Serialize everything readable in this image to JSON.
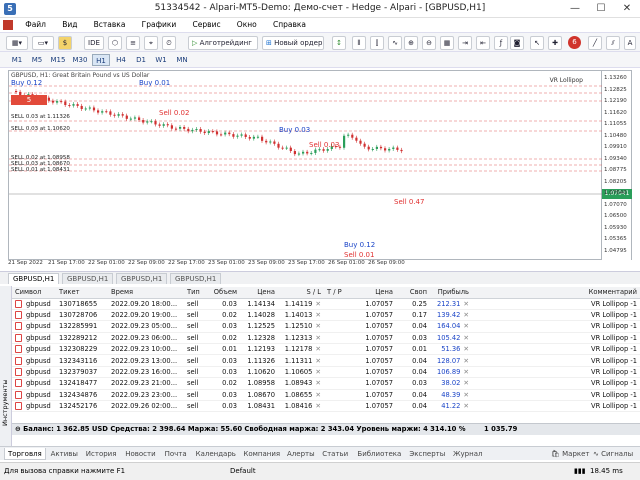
{
  "window": {
    "title": "51334542 - Alpari-MT5-Demo: Демо-счет - Hedge - Alpari - [GBPUSD,H1]"
  },
  "menu": [
    "Файл",
    "Вид",
    "Вставка",
    "Графики",
    "Сервис",
    "Окно",
    "Справка"
  ],
  "toolbar": {
    "ide": "IDE",
    "algo": "Алготрейдинг",
    "new_order": "Новый ордер",
    "badge": "6"
  },
  "timeframes": [
    "M1",
    "M5",
    "M15",
    "M30",
    "H1",
    "H4",
    "D1",
    "W1",
    "MN"
  ],
  "chart": {
    "header": "GBPUSD, H1: Great Britain Pound vs US Dollar",
    "expert": "VR Lollipop",
    "lot_badge": "5",
    "sell_labels": [
      "SELL 0.03 at 1.11326",
      "SELL 0.03 at 1.10620",
      "SELL 0.02 at 1.08958",
      "SELL 0.03 at 1.08670",
      "SELL 0.01 at 1.08431"
    ],
    "buy_labels": [
      "Buy 0.12",
      "Buy 0.01",
      "Buy 0.03",
      "Buy 0.12"
    ],
    "sell_small": [
      "Sell 0.02",
      "Sell 0.03",
      "Sell 0.01",
      "Sell 0.47"
    ],
    "current_price": "1.07041",
    "price_ticks": [
      "1.13260",
      "1.12825",
      "1.12190",
      "1.11620",
      "1.11055",
      "1.10480",
      "1.09910",
      "1.09340",
      "1.08775",
      "1.08205",
      "1.07640",
      "1.07070",
      "1.06500",
      "1.05930",
      "1.05365",
      "1.04795"
    ],
    "time_ticks": [
      "21 Sep 2022",
      "21 Sep 17:00",
      "22 Sep 01:00",
      "22 Sep 09:00",
      "22 Sep 17:00",
      "23 Sep 01:00",
      "23 Sep 09:00",
      "23 Sep 17:00",
      "26 Sep 01:00",
      "26 Sep 09:00"
    ]
  },
  "chart_tabs": [
    "GBPUSD,H1",
    "GBPUSD,H1",
    "GBPUSD,H1",
    "GBPUSD,H1"
  ],
  "table": {
    "headers": [
      "Символ",
      "Тикет",
      "Время",
      "Тип",
      "Объем",
      "Цена",
      "S / L",
      "T / P",
      "Цена",
      "Своп",
      "Прибыль",
      "Комментарий"
    ],
    "rows": [
      [
        "gbpusd",
        "130718655",
        "2022.09.20 18:00...",
        "sell",
        "0.03",
        "1.14134",
        "1.14119",
        "",
        "1.07057",
        "0.25",
        "212.31",
        "VR Lollipop -1"
      ],
      [
        "gbpusd",
        "130728706",
        "2022.09.20 19:00...",
        "sell",
        "0.02",
        "1.14028",
        "1.14013",
        "",
        "1.07057",
        "0.17",
        "139.42",
        "VR Lollipop -1"
      ],
      [
        "gbpusd",
        "132285991",
        "2022.09.23 05:00...",
        "sell",
        "0.03",
        "1.12525",
        "1.12510",
        "",
        "1.07057",
        "0.04",
        "164.04",
        "VR Lollipop -1"
      ],
      [
        "gbpusd",
        "132289212",
        "2022.09.23 06:00...",
        "sell",
        "0.02",
        "1.12328",
        "1.12313",
        "",
        "1.07057",
        "0.03",
        "105.42",
        "VR Lollipop -1"
      ],
      [
        "gbpusd",
        "132308229",
        "2022.09.23 10:00...",
        "sell",
        "0.01",
        "1.12193",
        "1.12178",
        "",
        "1.07057",
        "0.01",
        "51.36",
        "VR Lollipop -1"
      ],
      [
        "gbpusd",
        "132343116",
        "2022.09.23 13:00...",
        "sell",
        "0.03",
        "1.11326",
        "1.11311",
        "",
        "1.07057",
        "0.04",
        "128.07",
        "VR Lollipop -1"
      ],
      [
        "gbpusd",
        "132379037",
        "2022.09.23 16:00...",
        "sell",
        "0.03",
        "1.10620",
        "1.10605",
        "",
        "1.07057",
        "0.04",
        "106.89",
        "VR Lollipop -1"
      ],
      [
        "gbpusd",
        "132418477",
        "2022.09.23 21:00...",
        "sell",
        "0.02",
        "1.08958",
        "1.08943",
        "",
        "1.07057",
        "0.03",
        "38.02",
        "VR Lollipop -1"
      ],
      [
        "gbpusd",
        "132434876",
        "2022.09.23 23:00...",
        "sell",
        "0.03",
        "1.08670",
        "1.08655",
        "",
        "1.07057",
        "0.04",
        "48.39",
        "VR Lollipop -1"
      ],
      [
        "gbpusd",
        "132452176",
        "2022.09.26 02:00...",
        "sell",
        "0.03",
        "1.08431",
        "1.08416",
        "",
        "1.07057",
        "0.04",
        "41.22",
        "VR Lollipop -1"
      ]
    ]
  },
  "balance": {
    "text": "Баланс: 1 362.85 USD  Средства: 2 398.64  Маржа: 55.60  Свободная маржа: 2 343.04  Уровень маржи: 4 314.10 %",
    "total": "1 035.79"
  },
  "toolbox_label": "Инструменты",
  "bottom_tabs": [
    "Торговля",
    "Активы",
    "История",
    "Новости",
    "Почта",
    "Календарь",
    "Компания",
    "Алерты",
    "Статьи",
    "Библиотека",
    "Эксперты",
    "Журнал"
  ],
  "bottom_right": [
    "Маркет",
    "Сигналы"
  ],
  "status": {
    "help": "Для вызова справки нажмите F1",
    "profile": "Default",
    "ping": "18.45 ms"
  }
}
